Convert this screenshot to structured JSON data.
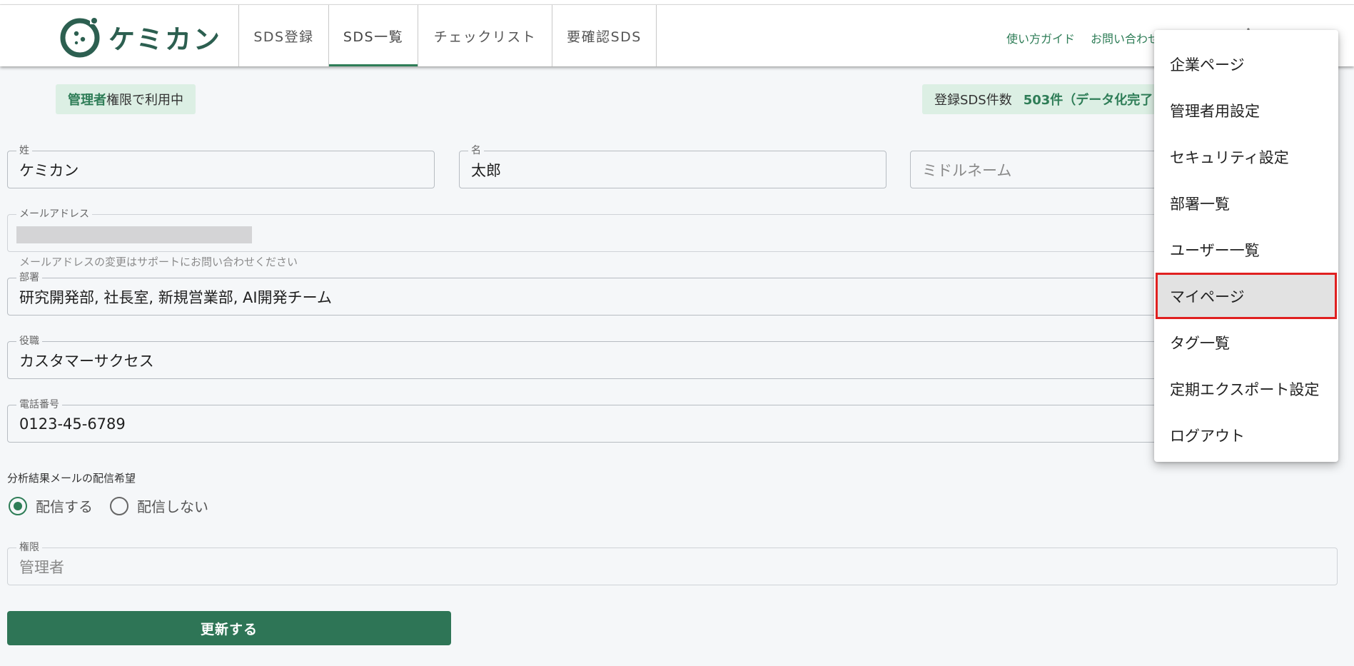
{
  "header": {
    "logo_text": "ケミカン",
    "tabs": [
      {
        "label": "SDS登録"
      },
      {
        "label": "SDS一覧"
      },
      {
        "label": "チェックリスト"
      },
      {
        "label": "要確認SDS"
      }
    ],
    "links": [
      "使い方ガイド",
      "お問い合わせ"
    ]
  },
  "status": {
    "admin_badge_highlight": "管理者",
    "admin_badge_rest": "権限で利用中",
    "count_label": "登録SDS件数",
    "count_value": "503件（データ化完了"
  },
  "form": {
    "last_name_label": "姓",
    "last_name": "ケミカン",
    "first_name_label": "名",
    "first_name": "太郎",
    "middle_name_placeholder": "ミドルネーム",
    "email_label": "メールアドレス",
    "email_helper": "メールアドレスの変更はサポートにお問い合わせください",
    "department_label": "部署",
    "department": "研究開発部, 社長室, 新規営業部, AI開発チーム",
    "position_label": "役職",
    "position": "カスタマーサクセス",
    "phone_label": "電話番号",
    "phone": "0123-45-6789",
    "mail_pref_label": "分析結果メールの配信希望",
    "mail_pref_options": [
      "配信する",
      "配信しない"
    ],
    "mail_pref_selected": "配信する",
    "role_label": "権限",
    "role": "管理者",
    "update_button": "更新する"
  },
  "menu": {
    "items": [
      "企業ページ",
      "管理者用設定",
      "セキュリティ設定",
      "部署一覧",
      "ユーザー一覧",
      "マイページ",
      "タグ一覧",
      "定期エクスポート設定",
      "ログアウト"
    ],
    "selected": "マイページ"
  },
  "colors": {
    "brand": "#2e7d57",
    "button": "#2e7556",
    "badge_bg": "#dcefe4",
    "highlight_outline": "#e02020"
  }
}
